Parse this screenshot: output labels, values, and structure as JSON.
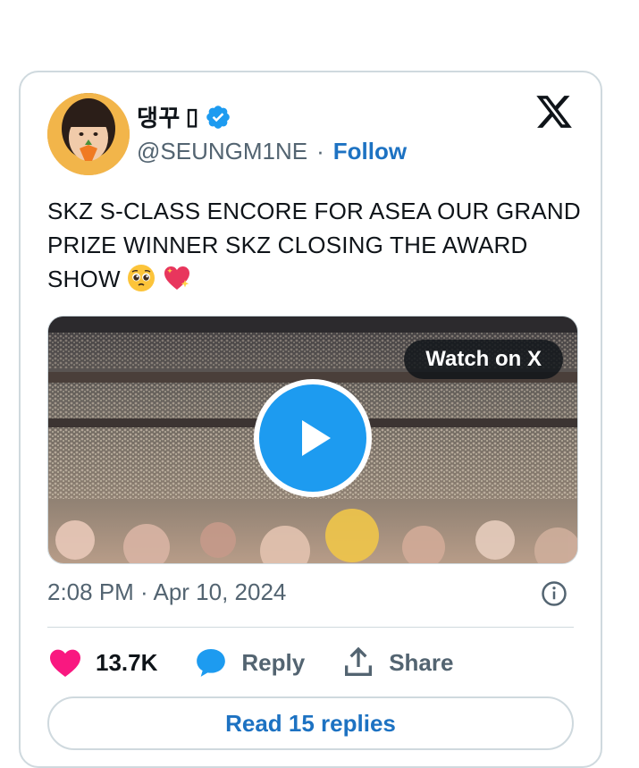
{
  "tweet": {
    "display_name": "댕꾸",
    "name_suffix_glyph": "▯",
    "handle": "@SEUNGM1NE",
    "separator": "·",
    "follow_label": "Follow",
    "text": "SKZ S-CLASS ENCORE FOR ASEA OUR GRAND PRIZE WINNER SKZ CLOSING THE AWARD SHOW",
    "emoji": [
      "pleading-face-emoji",
      "sparkling-heart-emoji"
    ],
    "media": {
      "watch_label": "Watch on X"
    },
    "timestamp": "2:08 PM · Apr 10, 2024",
    "actions": {
      "likes": "13.7K",
      "reply_label": "Reply",
      "share_label": "Share"
    },
    "read_replies_label": "Read 15 replies"
  },
  "colors": {
    "accent": "#1d9bf0",
    "link": "#1d72c2",
    "like": "#f91880",
    "muted": "#536471"
  },
  "icons": [
    "verified-badge-icon",
    "x-logo-icon",
    "play-icon",
    "info-icon",
    "heart-icon",
    "reply-bubble-icon",
    "share-icon"
  ]
}
